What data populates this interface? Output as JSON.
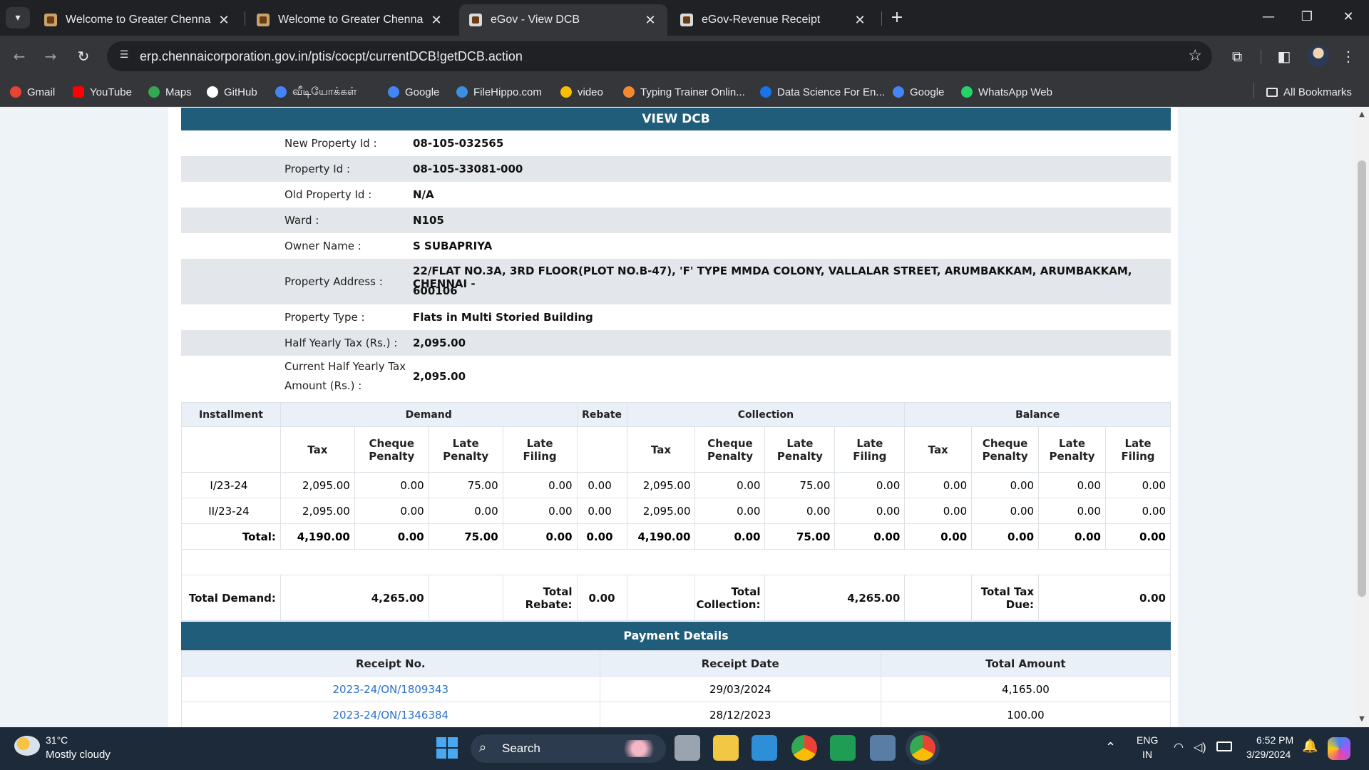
{
  "browser": {
    "tabs": [
      {
        "title": "Welcome to Greater Chennai Co",
        "active": false
      },
      {
        "title": "Welcome to Greater Chennai Co",
        "active": false
      },
      {
        "title": "eGov - View DCB",
        "active": true
      },
      {
        "title": "eGov-Revenue Receipt",
        "active": false
      }
    ],
    "url": "erp.chennaicorporation.gov.in/ptis/cocpt/currentDCB!getDCB.action",
    "bookmarks": [
      {
        "label": "Gmail",
        "color": "#ea4335"
      },
      {
        "label": "YouTube",
        "color": "#ff0000"
      },
      {
        "label": "Maps",
        "color": "#34a853"
      },
      {
        "label": "GitHub",
        "color": "#ffffff"
      },
      {
        "label": "வீடியோக்கள்",
        "color": "#4285f4"
      },
      {
        "label": "Google",
        "color": "#4285f4"
      },
      {
        "label": "FileHippo.com",
        "color": "#3d8fe0"
      },
      {
        "label": "video",
        "color": "#fbbc05"
      },
      {
        "label": "Typing Trainer Onlin...",
        "color": "#f28b30"
      },
      {
        "label": "Data Science For En...",
        "color": "#1a73e8"
      },
      {
        "label": "Google",
        "color": "#4285f4"
      },
      {
        "label": "WhatsApp Web",
        "color": "#25d366"
      }
    ],
    "all_bookmarks": "All Bookmarks"
  },
  "dcb": {
    "title": "VIEW DCB",
    "fields": [
      {
        "label": "New Property Id :",
        "value": "08-105-032565"
      },
      {
        "label": "Property Id :",
        "value": "08-105-33081-000"
      },
      {
        "label": "Old Property Id :",
        "value": "N/A"
      },
      {
        "label": "Ward :",
        "value": "N105"
      },
      {
        "label": "Owner Name :",
        "value": "S SUBAPRIYA"
      },
      {
        "label": "Property Address :",
        "value_line1": "22/FLAT NO.3A, 3RD FLOOR(PLOT NO.B-47), 'F' TYPE MMDA COLONY, VALLALAR STREET, ARUMBAKKAM, ARUMBAKKAM, CHENNAI -",
        "value_line2": "600106"
      },
      {
        "label": "Property Type :",
        "value": "Flats in Multi Storied Building"
      },
      {
        "label": "Half Yearly Tax (Rs.) :",
        "value": "2,095.00"
      },
      {
        "label_line1": "Current Half Yearly Tax",
        "label_line2": "Amount (Rs.) :",
        "value": "2,095.00"
      }
    ],
    "groups": {
      "installment": "Installment",
      "demand": "Demand",
      "rebate": "Rebate",
      "collection": "Collection",
      "balance": "Balance"
    },
    "sub": {
      "tax": "Tax",
      "cheque1": "Cheque",
      "cheque2": "Penalty",
      "late1": "Late",
      "late2": "Penalty",
      "filing1": "Late",
      "filing2": "Filing"
    },
    "rows": [
      {
        "inst": "I/23-24",
        "cells": [
          "2,095.00",
          "0.00",
          "75.00",
          "0.00",
          "0.00",
          "2,095.00",
          "0.00",
          "75.00",
          "0.00",
          "0.00",
          "0.00",
          "0.00",
          "0.00"
        ]
      },
      {
        "inst": "II/23-24",
        "cells": [
          "2,095.00",
          "0.00",
          "0.00",
          "0.00",
          "0.00",
          "2,095.00",
          "0.00",
          "0.00",
          "0.00",
          "0.00",
          "0.00",
          "0.00",
          "0.00"
        ]
      },
      {
        "inst": "Total:",
        "cells": [
          "4,190.00",
          "0.00",
          "75.00",
          "0.00",
          "0.00",
          "4,190.00",
          "0.00",
          "75.00",
          "0.00",
          "0.00",
          "0.00",
          "0.00",
          "0.00"
        ]
      }
    ],
    "summary": {
      "total_demand_label": "Total Demand:",
      "total_demand": "4,265.00",
      "total_rebate_l1": "Total",
      "total_rebate_l2": "Rebate:",
      "total_rebate": "0.00",
      "total_collection_l1": "Total",
      "total_collection_l2": "Collection:",
      "total_collection": "4,265.00",
      "total_tax_due_l1": "Total Tax",
      "total_tax_due_l2": "Due:",
      "total_tax_due": "0.00"
    }
  },
  "payment": {
    "title": "Payment Details",
    "headers": [
      "Receipt No.",
      "Receipt Date",
      "Total Amount"
    ],
    "rows": [
      {
        "receipt": "2023-24/ON/1809343",
        "date": "29/03/2024",
        "amount": "4,165.00"
      },
      {
        "receipt": "2023-24/ON/1346384",
        "date": "28/12/2023",
        "amount": "100.00"
      }
    ]
  },
  "taskbar": {
    "weather_temp": "31°C",
    "weather_desc": "Mostly cloudy",
    "search": "Search",
    "lang1": "ENG",
    "lang2": "IN",
    "time": "6:52 PM",
    "date": "3/29/2024"
  }
}
